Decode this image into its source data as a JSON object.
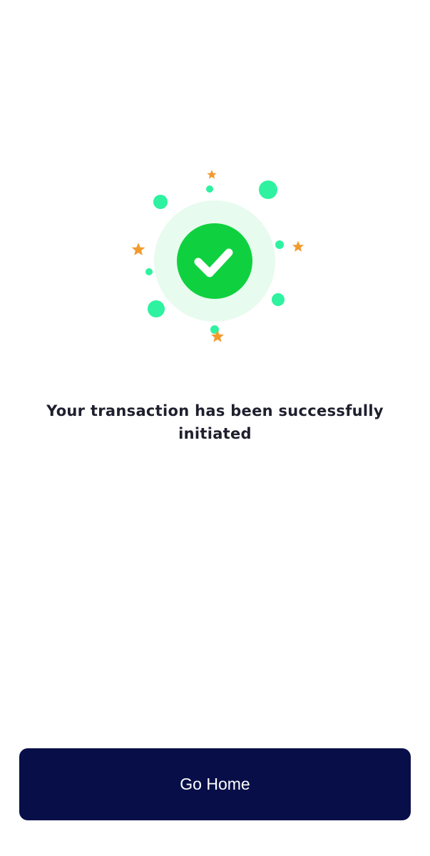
{
  "success": {
    "message": "Your transaction has been successfully initiated"
  },
  "actions": {
    "go_home_label": "Go Home"
  },
  "colors": {
    "check_circle": "#0fd13f",
    "check_halo": "#e7fbee",
    "confetti_dot": "#2ef29f",
    "confetti_star": "#f29a2e",
    "button_bg": "#080e48",
    "button_text": "#ffffff",
    "text": "#1f1f2e"
  },
  "icons": {
    "status": "check-circle-icon",
    "decoration": [
      "confetti-dot",
      "confetti-star"
    ]
  }
}
